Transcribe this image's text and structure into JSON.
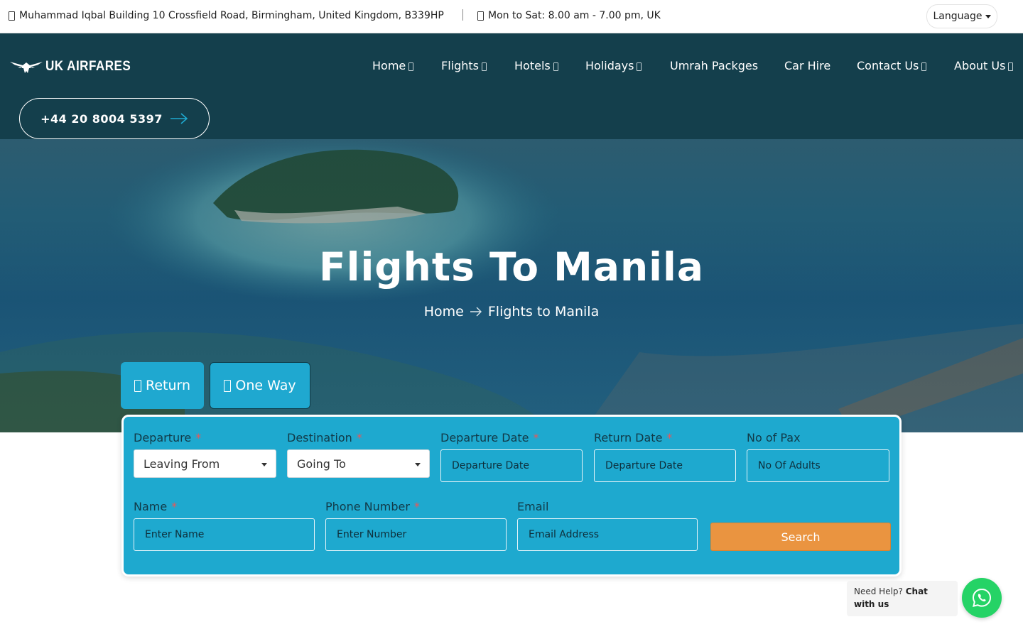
{
  "topbar": {
    "address_icon": "map-marker-icon",
    "address": "Muhammad Iqbal Building 10 Crossfield Road, Birmingham, United Kingdom, B339HP",
    "hours_icon": "clock-icon",
    "hours": "Mon to Sat: 8.00 am - 7.00 pm, UK",
    "language_label": "Language"
  },
  "header": {
    "logo_text": "UK AIRFARES",
    "nav": [
      {
        "label": "Home",
        "has_dropdown": true
      },
      {
        "label": "Flights",
        "has_dropdown": true
      },
      {
        "label": "Hotels",
        "has_dropdown": true
      },
      {
        "label": "Holidays",
        "has_dropdown": true
      },
      {
        "label": "Umrah Packges",
        "has_dropdown": false
      },
      {
        "label": "Car Hire",
        "has_dropdown": false
      },
      {
        "label": "Contact Us",
        "has_dropdown": true
      },
      {
        "label": "About Us",
        "has_dropdown": true
      }
    ],
    "phone": "+44 20 8004 5397"
  },
  "hero": {
    "title": "Flights To Manila",
    "breadcrumb": [
      "Home",
      "Flights to Manila"
    ]
  },
  "trip_tabs": {
    "return_label": "Return",
    "oneway_label": "One Way"
  },
  "form": {
    "departure": {
      "label": "Departure",
      "value": "Leaving From"
    },
    "destination": {
      "label": "Destination",
      "value": "Going To"
    },
    "departure_date": {
      "label": "Departure Date",
      "placeholder": "Departure Date"
    },
    "return_date": {
      "label": "Return Date",
      "placeholder": "Departure Date"
    },
    "pax": {
      "label": "No of Pax",
      "placeholder": "No Of Adults"
    },
    "name": {
      "label": "Name",
      "placeholder": "Enter Name"
    },
    "phone": {
      "label": "Phone Number",
      "placeholder": "Enter Number"
    },
    "email": {
      "label": "Email",
      "placeholder": "Email Address"
    },
    "required_mark": "*",
    "search_label": "Search"
  },
  "chat": {
    "need_help": "Need Help?",
    "cta": "Chat with us",
    "icon": "whatsapp-icon"
  },
  "colors": {
    "header_bg": "#143f4c",
    "panel_bg": "#1ea9cf",
    "search_btn": "#ea9440",
    "whatsapp": "#25d366"
  }
}
